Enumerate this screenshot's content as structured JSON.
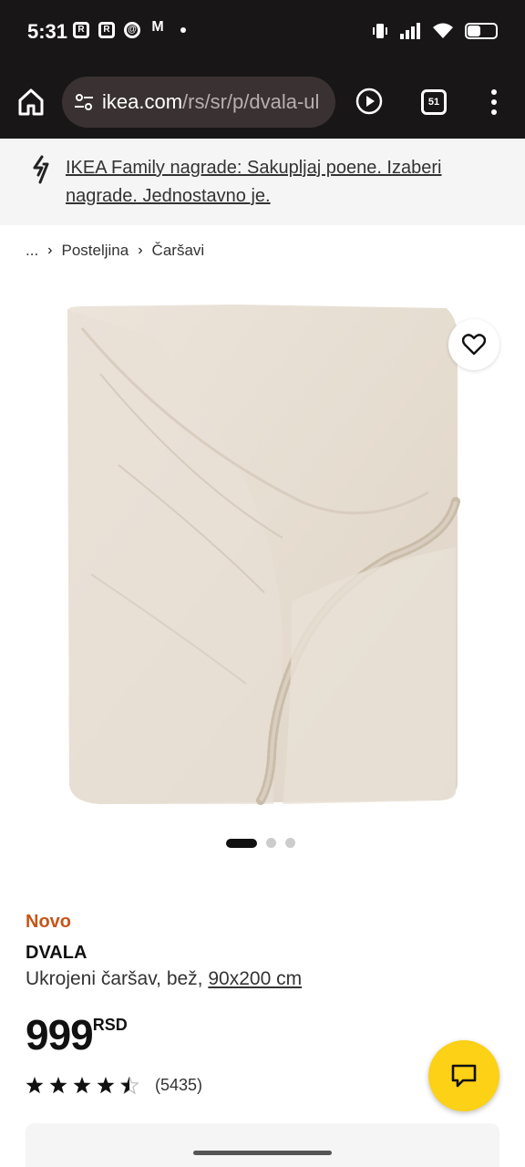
{
  "status_bar": {
    "time": "5:31",
    "notification_icons": [
      "R",
      "R",
      "@",
      "M"
    ]
  },
  "browser": {
    "url_domain": "ikea.com",
    "url_path": "/rs/sr/p/dvala-ul",
    "tab_count": "51"
  },
  "promo": {
    "text": "IKEA Family nagrade: Sakupljaj poene. Izaberi nagrade. Jednostavno je."
  },
  "breadcrumb": {
    "ellipsis": "...",
    "items": [
      "Posteljina",
      "Čaršavi"
    ]
  },
  "product": {
    "badge": "Novo",
    "name": "DVALA",
    "description": "Ukrojeni čaršav, bež,",
    "size": "90x200 cm",
    "price": "999",
    "currency": "RSD",
    "rating_value": 4.5,
    "review_count": "(5435)",
    "image_count": 3,
    "active_image": 1
  },
  "colors": {
    "accent_new": "#c4571a",
    "chat_fab": "#fcd116",
    "browser_bg": "#181616"
  }
}
